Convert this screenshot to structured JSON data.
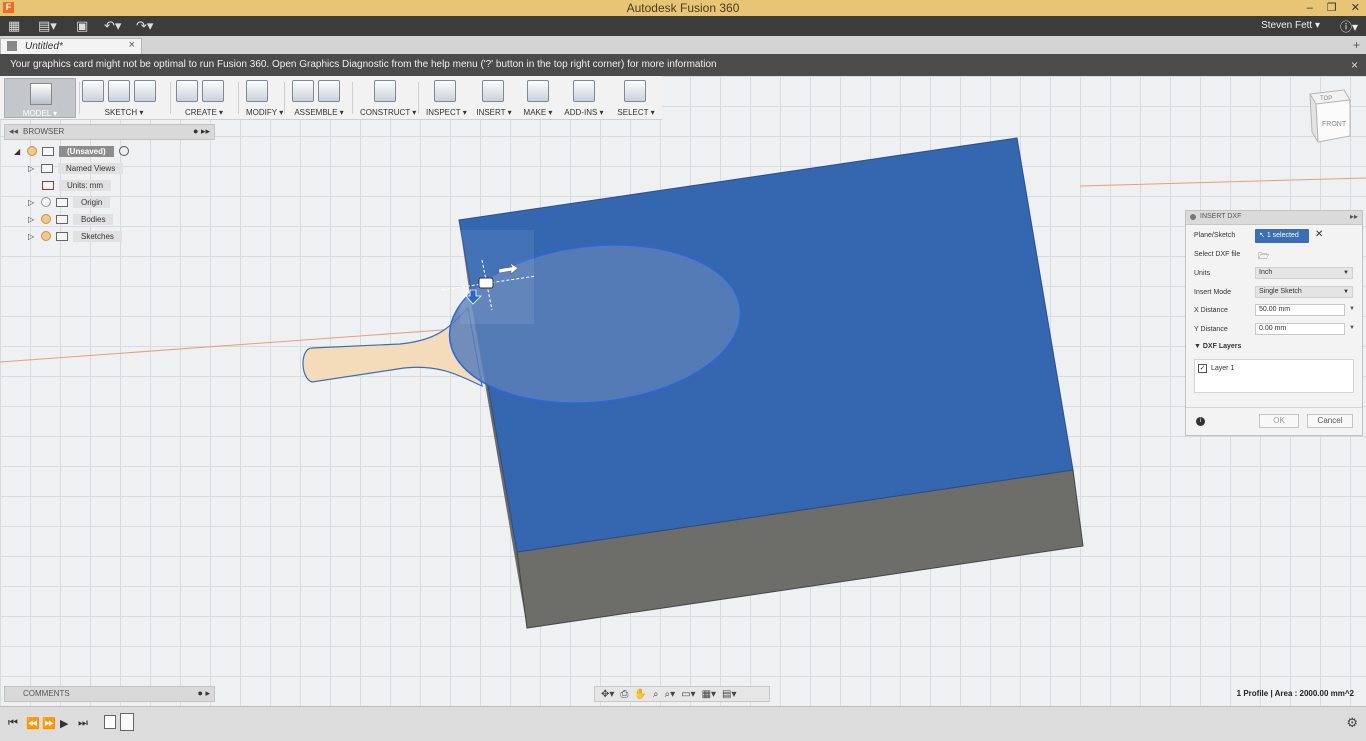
{
  "window": {
    "title": "Autodesk Fusion 360",
    "app_letter": "F"
  },
  "qa": {
    "user": "Steven Fett ▾",
    "help": "?"
  },
  "tab": {
    "label": "Untitled*",
    "close": "×",
    "add": "+"
  },
  "warning": {
    "text": "Your graphics card might not be optimal to run Fusion 360. Open Graphics Diagnostic from the help menu ('?' button in the top right corner) for more information",
    "close": "×"
  },
  "toolbar": {
    "model": "MODEL ▾",
    "sketch": "SKETCH ▾",
    "create": "CREATE ▾",
    "modify": "MODIFY ▾",
    "assemble": "ASSEMBLE ▾",
    "construct": "CONSTRUCT ▾",
    "inspect": "INSPECT ▾",
    "insert": "INSERT ▾",
    "make": "MAKE ▾",
    "addins": "ADD-INS ▾",
    "select": "SELECT ▾"
  },
  "browser": {
    "title": "BROWSER",
    "root": "(Unsaved)",
    "items": [
      {
        "label": "Named Views"
      },
      {
        "label": "Units: mm"
      },
      {
        "label": "Origin"
      },
      {
        "label": "Bodies"
      },
      {
        "label": "Sketches"
      }
    ]
  },
  "viewcube": {
    "top": "TOP",
    "front": "FRONT"
  },
  "comments": {
    "title": "COMMENTS"
  },
  "status": {
    "text": "1 Profile | Area : 2000.00 mm^2"
  },
  "dxf": {
    "title": "INSERT DXF",
    "plane_label": "Plane/Sketch",
    "plane_value": "1 selected",
    "file_label": "Select DXF file",
    "units_label": "Units",
    "units_value": "Inch",
    "mode_label": "Insert Mode",
    "mode_value": "Single Sketch",
    "x_label": "X Distance",
    "x_value": "50.00 mm",
    "y_label": "Y Distance",
    "y_value": "0.00 mm",
    "layers_label": "DXF Layers",
    "layer_1": "Layer 1",
    "ok": "OK",
    "cancel": "Cancel"
  },
  "colors": {
    "face_blue": "#3566b0",
    "side_gray": "#6d6d6a",
    "handle_fill": "#f4dcba",
    "title_bar": "#e8c576"
  }
}
